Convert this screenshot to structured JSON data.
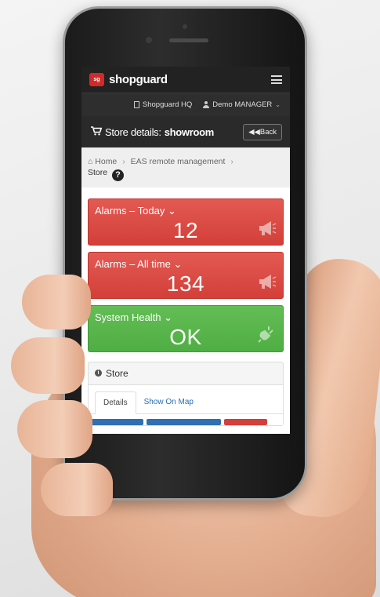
{
  "app": {
    "brand": "shopguard",
    "logo_mark": "sg"
  },
  "subnav": {
    "location": "Shopguard HQ",
    "user": "Demo MANAGER"
  },
  "header": {
    "title_prefix": "Store details:",
    "title_name": "showroom",
    "back_label": "Back"
  },
  "breadcrumb": {
    "home": "Home",
    "section": "EAS remote management",
    "current": "Store"
  },
  "tiles": [
    {
      "label": "Alarms – Today",
      "value": "12",
      "icon": "megaphone-icon",
      "color": "#d9463f"
    },
    {
      "label": "Alarms – All time",
      "value": "134",
      "icon": "megaphone-icon",
      "color": "#d9463f"
    },
    {
      "label": "System Health",
      "value": "OK",
      "icon": "plug-icon",
      "color": "#58b54b"
    }
  ],
  "store_panel": {
    "title": "Store",
    "tabs": [
      {
        "label": "Details",
        "active": true
      },
      {
        "label": "Show On Map",
        "active": false
      }
    ]
  }
}
